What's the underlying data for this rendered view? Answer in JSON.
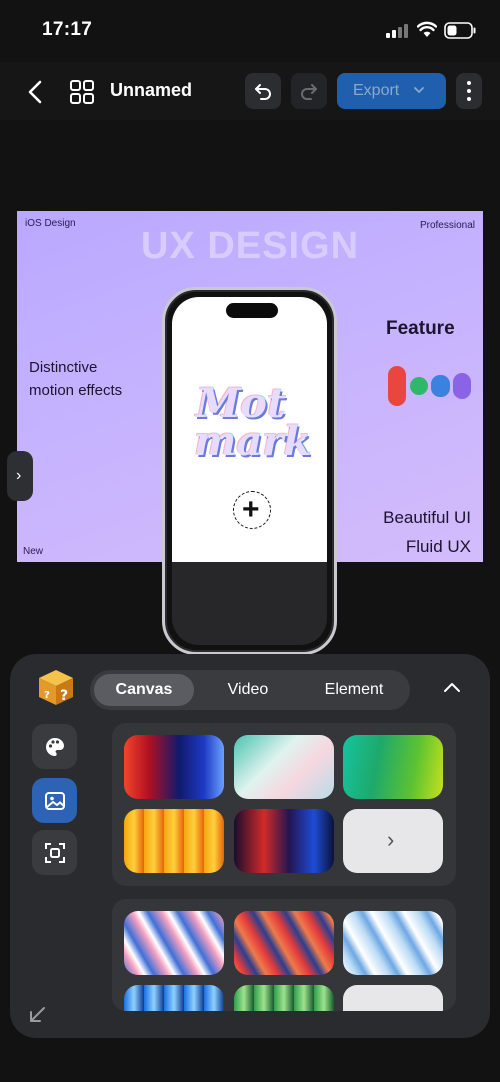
{
  "status": {
    "time": "17:17"
  },
  "nav": {
    "title": "Unnamed",
    "export_label": "Export"
  },
  "canvas": {
    "tag_top_left": "iOS Design",
    "tag_top_right": "Professional",
    "tag_bottom_left": "New",
    "headline": "UX DESIGN",
    "left_line1": "Distinctive",
    "left_line2": "motion effects",
    "feature_title": "Feature",
    "feature_colors": [
      "#e9463f",
      "#2fb86a",
      "#3b82e0",
      "#8a63e6"
    ],
    "right_line1": "Beautiful UI",
    "right_line2": "Fluid UX",
    "phone_logo_line1": "Mot",
    "phone_logo_line2": "mark",
    "add_symbol": "+"
  },
  "panel": {
    "tabs": [
      {
        "label": "Canvas",
        "active": true
      },
      {
        "label": "Video",
        "active": false
      },
      {
        "label": "Element",
        "active": false
      }
    ],
    "tools": [
      {
        "icon": "palette-icon",
        "active": false
      },
      {
        "icon": "image-icon",
        "active": true
      },
      {
        "icon": "frame-icon",
        "active": false
      }
    ],
    "more_symbol": "›"
  }
}
